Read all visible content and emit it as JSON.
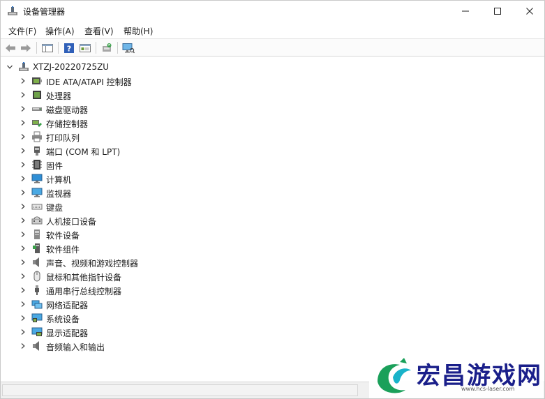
{
  "window": {
    "title": "设备管理器"
  },
  "menubar": {
    "items": [
      "文件(F)",
      "操作(A)",
      "查看(V)",
      "帮助(H)"
    ]
  },
  "toolbar": {
    "icons": [
      "back-arrow-icon",
      "forward-arrow-icon",
      "show-hide-tree-icon",
      "help-icon",
      "properties-icon",
      "update-driver-icon",
      "scan-hardware-icon"
    ]
  },
  "tree": {
    "root": "XTZJ-20220725ZU",
    "items": [
      {
        "label": "IDE ATA/ATAPI 控制器",
        "icon": "ide-controller-icon"
      },
      {
        "label": "处理器",
        "icon": "processor-icon"
      },
      {
        "label": "磁盘驱动器",
        "icon": "disk-drive-icon"
      },
      {
        "label": "存储控制器",
        "icon": "storage-controller-icon"
      },
      {
        "label": "打印队列",
        "icon": "printer-icon"
      },
      {
        "label": "端口 (COM 和 LPT)",
        "icon": "port-icon"
      },
      {
        "label": "固件",
        "icon": "firmware-icon"
      },
      {
        "label": "计算机",
        "icon": "computer-icon"
      },
      {
        "label": "监视器",
        "icon": "monitor-icon"
      },
      {
        "label": "键盘",
        "icon": "keyboard-icon"
      },
      {
        "label": "人机接口设备",
        "icon": "hid-icon"
      },
      {
        "label": "软件设备",
        "icon": "software-device-icon"
      },
      {
        "label": "软件组件",
        "icon": "software-component-icon"
      },
      {
        "label": "声音、视频和游戏控制器",
        "icon": "sound-icon"
      },
      {
        "label": "鼠标和其他指针设备",
        "icon": "mouse-icon"
      },
      {
        "label": "通用串行总线控制器",
        "icon": "usb-icon"
      },
      {
        "label": "网络适配器",
        "icon": "network-adapter-icon"
      },
      {
        "label": "系统设备",
        "icon": "system-device-icon"
      },
      {
        "label": "显示适配器",
        "icon": "display-adapter-icon"
      },
      {
        "label": "音频输入和输出",
        "icon": "audio-io-icon"
      }
    ]
  },
  "watermark": {
    "text": "宏昌游戏网",
    "subtext": "www.hcs-laser.com"
  },
  "colors": {
    "accent": "#1a1f8a",
    "logo_green": "#1aa05a",
    "logo_cyan": "#19b3c9"
  }
}
